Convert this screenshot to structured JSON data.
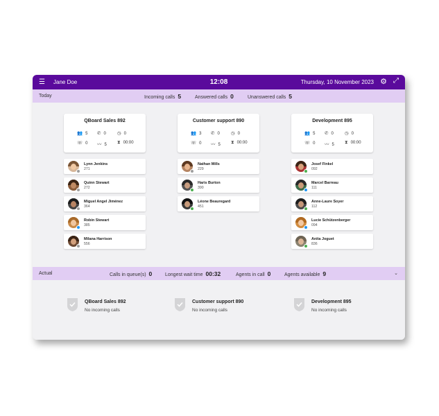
{
  "header": {
    "user": "Jane Doe",
    "time": "12:08",
    "date": "Thursday, 10 November 2023",
    "menu_icon": "hamburger-icon",
    "settings_icon": "gear-icon",
    "expand_icon": "expand-icon"
  },
  "today": {
    "label": "Today",
    "incoming_label": "Incoming calls",
    "incoming_value": "5",
    "answered_label": "Answered calls",
    "answered_value": "0",
    "unanswered_label": "Unanswered calls",
    "unanswered_value": "5"
  },
  "groups": [
    {
      "title": "QBoard Sales 892",
      "stats": [
        "5",
        "0",
        "0",
        "0",
        "5",
        "00:00"
      ],
      "agents": [
        {
          "name": "Lynn Jenkins",
          "ext": "271",
          "status_color": "#9e9e9e"
        },
        {
          "name": "Quinn Stewart",
          "ext": "272",
          "status_color": "#9e9e9e"
        },
        {
          "name": "Miguel Angel Jiménez",
          "ext": "364",
          "status_color": "#9e9e9e"
        },
        {
          "name": "Robin Stewart",
          "ext": "385",
          "status_color": "#9e9e9e"
        },
        {
          "name": "Milana Harrison",
          "ext": "556",
          "status_color": "#9e9e9e"
        }
      ]
    },
    {
      "title": "Customer support 890",
      "stats": [
        "3",
        "0",
        "0",
        "0",
        "5",
        "00:00"
      ],
      "agents": [
        {
          "name": "Nathan Mills",
          "ext": "229",
          "status_color": "#4caf50"
        },
        {
          "name": "Haris Burton",
          "ext": "390",
          "status_color": "#4caf50"
        },
        {
          "name": "Léone Beauregard",
          "ext": "451",
          "status_color": "#4caf50"
        }
      ]
    },
    {
      "title": "Development 895",
      "stats": [
        "5",
        "0",
        "0",
        "0",
        "5",
        "00:00"
      ],
      "agents": [
        {
          "name": "Josef Finkel",
          "ext": "092",
          "status_color": "#4caf50"
        },
        {
          "name": "Marcel Barreau",
          "ext": "111",
          "status_color": "#2196f3"
        },
        {
          "name": "Anne-Laure Soyer",
          "ext": "112",
          "status_color": "#4caf50"
        },
        {
          "name": "Lucie Schützenberger",
          "ext": "094",
          "status_color": "#2196f3"
        },
        {
          "name": "Anita Joguet",
          "ext": "836",
          "status_color": "#4caf50"
        }
      ]
    }
  ],
  "actual": {
    "label": "Actual",
    "queue_label": "Calls in queue(s)",
    "queue_value": "0",
    "wait_label": "Longest wait time",
    "wait_value": "00:32",
    "incall_label": "Agents in call",
    "incall_value": "0",
    "available_label": "Agents available",
    "available_value": "9",
    "chevron_icon": "chevron-down-icon"
  },
  "queues": [
    {
      "name": "QBoard Sales 892",
      "status": "No incoming calls"
    },
    {
      "name": "Customer support 890",
      "status": "No incoming calls"
    },
    {
      "name": "Development 895",
      "status": "No incoming calls"
    }
  ],
  "colors": {
    "header": "#5a0a9c",
    "strip": "#e1cdf3",
    "background": "#f1f1f3"
  }
}
